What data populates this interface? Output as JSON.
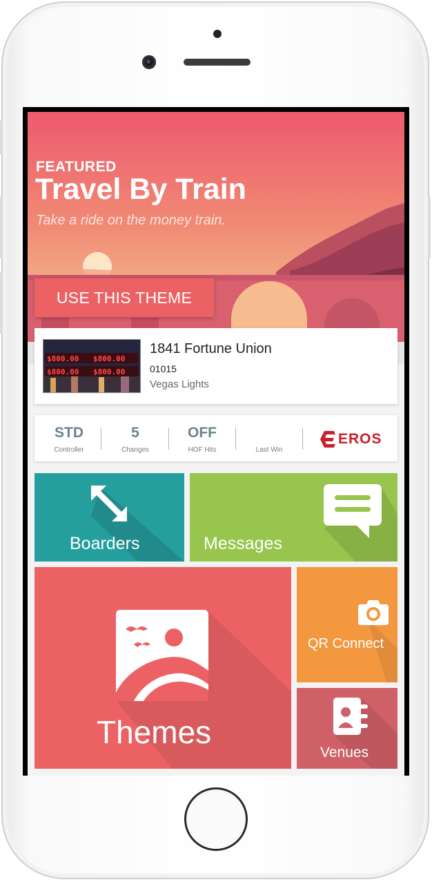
{
  "featured": {
    "tag": "FEATURED",
    "title": "Travel By Train",
    "subtitle": "Take a ride on the money train.",
    "button_label": "USE THIS THEME"
  },
  "machine": {
    "name": "1841 Fortune Union",
    "number": "01015",
    "theme": "Vegas Lights",
    "thumb_values": [
      "$800.00",
      "$800.00",
      "$800.00",
      "$800.00"
    ]
  },
  "stats": [
    {
      "value": "STD",
      "label": "Controller"
    },
    {
      "value": "5",
      "label": "Changes"
    },
    {
      "value": "OFF",
      "label": "HOF Hits"
    },
    {
      "value": "",
      "label": "Last Win"
    }
  ],
  "brand": {
    "name": "EROS",
    "color": "#c8202a"
  },
  "tiles": {
    "boarders": {
      "label": "Boarders",
      "icon": "expand-arrows-icon",
      "color": "#259f9e"
    },
    "messages": {
      "label": "Messages",
      "icon": "chat-bubble-icon",
      "color": "#97c54d"
    },
    "themes": {
      "label": "Themes",
      "icon": "image-landscape-icon",
      "color": "#ec6264"
    },
    "qr_connect": {
      "label": "QR Connect",
      "icon": "camera-icon",
      "color": "#f4983f"
    },
    "venues": {
      "label": "Venues",
      "icon": "contacts-icon",
      "color": "#cf6067"
    }
  }
}
